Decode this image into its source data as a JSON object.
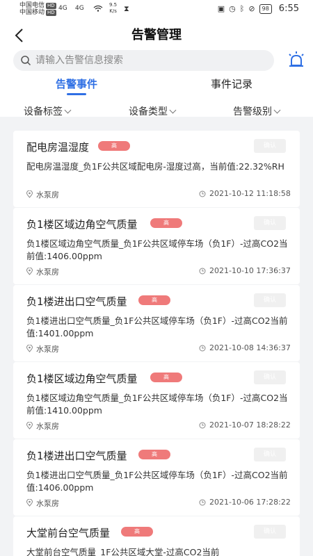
{
  "status_bar": {
    "carrier1": "中国电信",
    "carrier2": "中国移动",
    "hd": "HD",
    "signal1": "4G",
    "signal2": "4G",
    "speed_value": "9.5",
    "speed_unit": "K/s",
    "battery": "98",
    "time": "6:55"
  },
  "header": {
    "title": "告警管理",
    "search_placeholder": "请输入告警信息搜索"
  },
  "tabs": [
    {
      "label": "告警事件",
      "active": true
    },
    {
      "label": "事件记录",
      "active": false
    }
  ],
  "filters": [
    {
      "label": "设备标签"
    },
    {
      "label": "设备类型"
    },
    {
      "label": "告警级别"
    }
  ],
  "alerts": [
    {
      "title": "配电房温湿度",
      "level": "高",
      "confirm": "确认",
      "desc": "配电房温湿度_负1F公共区域配电房-湿度过高，当前值:22.32%RH",
      "location": "水泵房",
      "time": "2021-10-12 11:18:58"
    },
    {
      "title": "负1楼区域边角空气质量",
      "level": "高",
      "confirm": "确认",
      "desc": "负1楼区域边角空气质量_负1F公共区域停车场（负1F）-过高CO2当前值:1406.00ppm",
      "location": "水泵房",
      "time": "2021-10-10 17:36:37"
    },
    {
      "title": "负1楼进出口空气质量",
      "level": "高",
      "confirm": "确认",
      "desc": "负1楼进出口空气质量_负1F公共区域停车场（负1F）-过高CO2当前值:1401.00ppm",
      "location": "水泵房",
      "time": "2021-10-08 14:36:37"
    },
    {
      "title": "负1楼区域边角空气质量",
      "level": "高",
      "confirm": "确认",
      "desc": "负1楼区域边角空气质量_负1F公共区域停车场（负1F）-过高CO2当前值:1410.00ppm",
      "location": "水泵房",
      "time": "2021-10-07 18:28:22"
    },
    {
      "title": "负1楼进出口空气质量",
      "level": "高",
      "confirm": "确认",
      "desc": "负1楼进出口空气质量_负1F公共区域停车场（负1F）-过高CO2当前值:1406.00ppm",
      "location": "水泵房",
      "time": "2021-10-06 17:28:22"
    },
    {
      "title": "大堂前台空气质量",
      "level": "高",
      "confirm": "确认",
      "desc": "大堂前台空气质量_1F公共区域大堂-过高CO2当前",
      "location": "",
      "time": ""
    }
  ],
  "colors": {
    "accent": "#2f6fe4",
    "badge": "#ef7a7a",
    "background": "#f2f3f5"
  }
}
